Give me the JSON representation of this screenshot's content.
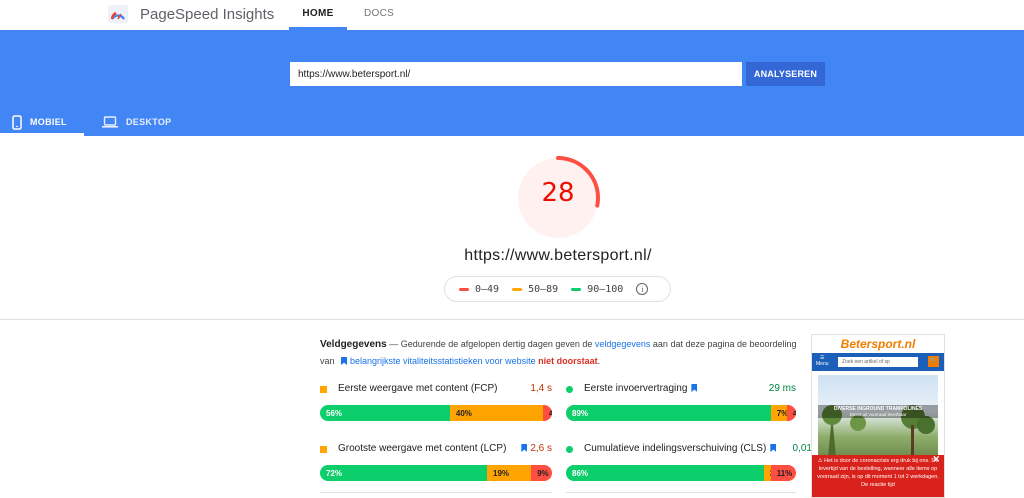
{
  "header": {
    "app_title": "PageSpeed Insights",
    "nav": [
      {
        "label": "HOME"
      },
      {
        "label": "DOCS"
      }
    ],
    "active_nav": "HOME"
  },
  "search": {
    "url_value": "https://www.betersport.nl/",
    "analyze_label": "ANALYSEREN"
  },
  "device_tabs": [
    {
      "label": "MOBIEL",
      "icon": "phone-icon",
      "active": true
    },
    {
      "label": "DESKTOP",
      "icon": "laptop-icon",
      "active": false
    }
  ],
  "score": {
    "value": "28",
    "fraction": 0.28,
    "color": "#eb0f00",
    "analyzed_url": "https://www.betersport.nl/"
  },
  "legend": {
    "items": [
      {
        "label": "0–49",
        "color": "#ff4e42"
      },
      {
        "label": "50–89",
        "color": "#ffa400"
      },
      {
        "label": "90–100",
        "color": "#0cce6b"
      }
    ],
    "info_icon": "info-icon"
  },
  "field_data": {
    "title": "Veldgegevens",
    "desc_1": " — Gedurende de afgelopen dertig dagen geven de ",
    "desc_link_1": "veldgegevens",
    "desc_2": " aan dat deze pagina de beoordeling van ",
    "desc_link_2": "belangrijkste vitaliteitsstatistieken voor website",
    "desc_3": " ",
    "desc_fail": "niet doorstaat",
    "desc_4": "."
  },
  "metrics": {
    "fcp": {
      "name": "Eerste weergave met content (FCP)",
      "value": "1,4 s",
      "good": "56%",
      "avg": "40%",
      "poor": "4%",
      "good_pct": 56,
      "avg_pct": 40,
      "poor_pct": 4
    },
    "fid": {
      "name": "Eerste invoervertraging",
      "value": "29 ms",
      "good": "89%",
      "avg": "7%",
      "poor": "4%",
      "good_pct": 89,
      "avg_pct": 7,
      "poor_pct": 4
    },
    "lcp": {
      "name": "Grootste weergave met content (LCP)",
      "value": "2,6 s",
      "good": "72%",
      "avg": "19%",
      "poor": "9%",
      "good_pct": 72,
      "avg_pct": 19,
      "poor_pct": 9
    },
    "cls": {
      "name": "Cumulatieve indelingsverschuiving (CLS)",
      "value": "0,01",
      "good": "86%",
      "avg": "3%",
      "poor": "11%",
      "good_pct": 86,
      "avg_pct": 3,
      "poor_pct": 11
    }
  },
  "screenshot": {
    "logo": "Betersport.nl",
    "menu": "Menu",
    "search_placeholder": "Zoek een artikel of sp",
    "banner_title": "DIVERSE INGROUND TRAMPOLINES",
    "banner_sub": "Direct uit voorraad leverbaar",
    "alert": "Het is door de coronacrisis erg druk bij ons. De levertijd van de bestelling, wanneer alle items op voorraad zijn, is op dit moment 1 tot 2 werkdagen. De reactie tijd"
  }
}
